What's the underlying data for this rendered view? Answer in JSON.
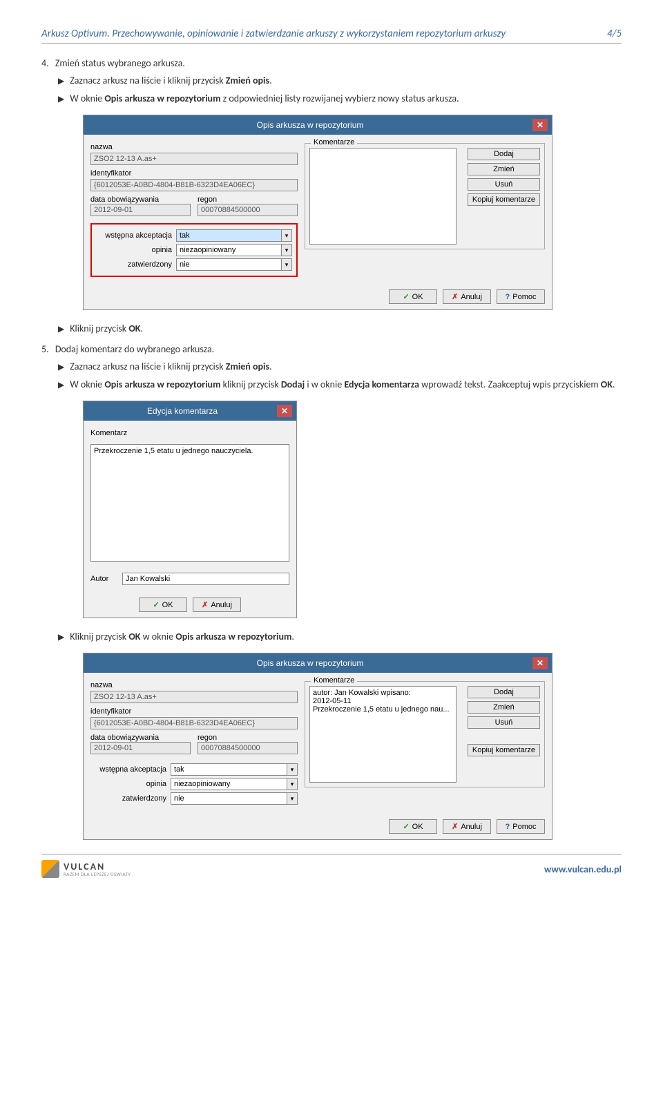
{
  "header": {
    "title": "Arkusz Optivum. Przechowywanie, opiniowanie i zatwierdzanie arkuszy z wykorzystaniem repozytorium arkuszy",
    "page": "4/5"
  },
  "steps": {
    "s4_num": "4.",
    "s4_text": "Zmień status wybranego arkusza.",
    "s4_b1_a": "Zaznacz arkusz na liście i kliknij przycisk ",
    "s4_b1_b": "Zmień opis",
    "s4_b1_c": ".",
    "s4_b2_a": "W oknie ",
    "s4_b2_b": "Opis arkusza w repozytorium",
    "s4_b2_c": " z odpowiedniej listy rozwijanej wybierz nowy status arkusza.",
    "s4_b3_a": "Kliknij przycisk ",
    "s4_b3_b": "OK",
    "s4_b3_c": ".",
    "s5_num": "5.",
    "s5_text": "Dodaj komentarz do wybranego arkusza.",
    "s5_b1_a": "Zaznacz arkusz na liście i kliknij przycisk ",
    "s5_b1_b": "Zmień opis",
    "s5_b1_c": ".",
    "s5_b2_a": "W oknie ",
    "s5_b2_b": "Opis arkusza w repozytorium",
    "s5_b2_c": " kliknij przycisk ",
    "s5_b2_d": "Dodaj",
    "s5_b2_e": " i w oknie ",
    "s5_b2_f": "Edycja komentarza",
    "s5_b2_g": " wprowadź tekst. Zaakceptuj wpis przyciskiem ",
    "s5_b2_h": "OK",
    "s5_b2_i": ".",
    "s5_b3_a": "Kliknij przycisk ",
    "s5_b3_b": "OK",
    "s5_b3_c": " w oknie ",
    "s5_b3_d": "Opis arkusza w repozytorium",
    "s5_b3_e": "."
  },
  "dialog1": {
    "title": "Opis arkusza w repozytorium",
    "lbl_nazwa": "nazwa",
    "nazwa": "ZSO2 12-13 A.as+",
    "lbl_id": "identyfikator",
    "id": "{6012053E-A0BD-4804-B81B-6323D4EA06EC}",
    "lbl_data": "data obowiązywania",
    "data": "2012-09-01",
    "lbl_regon": "regon",
    "regon": "00070884500000",
    "lbl_wa": "wstępna akceptacja",
    "wa": "tak",
    "lbl_opinia": "opinia",
    "opinia": "niezaopiniowany",
    "lbl_zat": "zatwierdzony",
    "zat": "nie",
    "legend": "Komentarze",
    "btn_dodaj": "Dodaj",
    "btn_zmien": "Zmień",
    "btn_usun": "Usuń",
    "btn_kopiuj": "Kopiuj komentarze",
    "ok": "OK",
    "anuluj": "Anuluj",
    "pomoc": "Pomoc"
  },
  "dialog2": {
    "title": "Edycja komentarza",
    "lbl_kom": "Komentarz",
    "text": "Przekroczenie 1,5 etatu u jednego nauczyciela.",
    "lbl_autor": "Autor",
    "autor": "Jan Kowalski",
    "ok": "OK",
    "anuluj": "Anuluj"
  },
  "dialog3": {
    "title": "Opis arkusza w repozytorium",
    "lbl_nazwa": "nazwa",
    "nazwa": "ZSO2 12-13 A.as+",
    "lbl_id": "identyfikator",
    "id": "{6012053E-A0BD-4804-B81B-6323D4EA06EC}",
    "lbl_data": "data obowiązywania",
    "data": "2012-09-01",
    "lbl_regon": "regon",
    "regon": "00070884500000",
    "lbl_wa": "wstępna akceptacja",
    "wa": "tak",
    "lbl_opinia": "opinia",
    "opinia": "niezaopiniowany",
    "lbl_zat": "zatwierdzony",
    "zat": "nie",
    "legend": "Komentarze",
    "c1": "autor: Jan Kowalski wpisano:",
    "c2": "2012-05-11",
    "c3": "Przekroczenie 1,5 etatu u jednego nau...",
    "btn_dodaj": "Dodaj",
    "btn_zmien": "Zmień",
    "btn_usun": "Usuń",
    "btn_kopiuj": "Kopiuj komentarze",
    "ok": "OK",
    "anuluj": "Anuluj",
    "pomoc": "Pomoc"
  },
  "footer": {
    "brand": "VULCAN",
    "tag": "RAZEM DLA LEPSZEJ OŚWIATY",
    "url": "www.vulcan.edu.pl"
  }
}
